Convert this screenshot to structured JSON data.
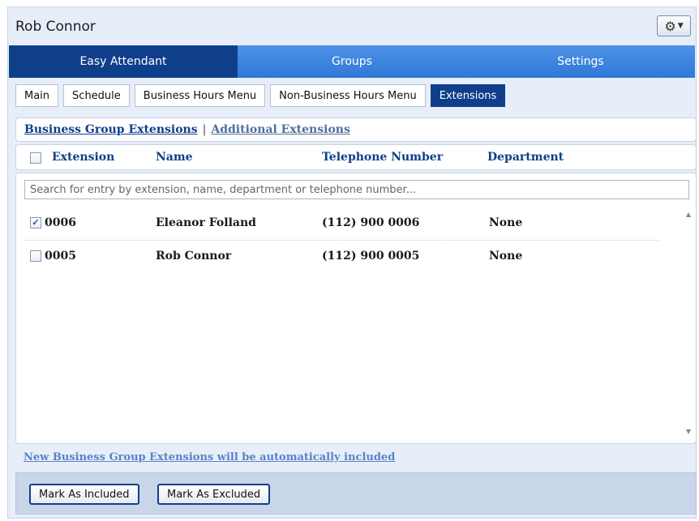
{
  "window": {
    "title": "Rob Connor",
    "settings_icon": "gear-icon"
  },
  "main_tabs": [
    {
      "label": "Easy Attendant",
      "active": true
    },
    {
      "label": "Groups",
      "active": false
    },
    {
      "label": "Settings",
      "active": false
    }
  ],
  "sub_tabs": [
    {
      "label": "Main",
      "active": false
    },
    {
      "label": "Schedule",
      "active": false
    },
    {
      "label": "Business Hours Menu",
      "active": false
    },
    {
      "label": "Non-Business Hours Menu",
      "active": false
    },
    {
      "label": "Extensions",
      "active": true
    }
  ],
  "extension_links": {
    "business": "Business Group Extensions",
    "separator": "|",
    "additional": "Additional Extensions"
  },
  "columns": {
    "extension": "Extension",
    "name": "Name",
    "telephone": "Telephone Number",
    "department": "Department"
  },
  "search": {
    "placeholder": "Search for entry by extension, name, department or telephone number...",
    "value": ""
  },
  "rows": [
    {
      "checked": true,
      "extension": "0006",
      "name": "Eleanor Folland",
      "telephone": "(112) 900 0006",
      "department": "None"
    },
    {
      "checked": false,
      "extension": "0005",
      "name": "Rob Connor",
      "telephone": "(112) 900 0005",
      "department": "None"
    }
  ],
  "notice": "New Business Group Extensions will be automatically included",
  "buttons": {
    "include": "Mark As Included",
    "exclude": "Mark As Excluded"
  },
  "colors": {
    "active_tab": "#0f3f8a",
    "tab_bar": "#3a82dc",
    "panel_bg": "#e7eef9",
    "link": "#0f3f8a"
  }
}
